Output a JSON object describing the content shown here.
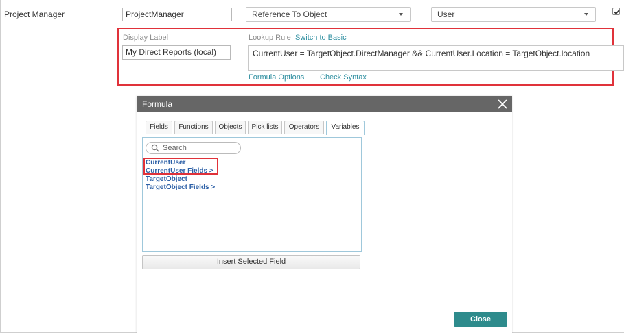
{
  "row": {
    "name_value": "Project Manager",
    "api_name_value": "ProjectManager",
    "type_selected": "Reference To Object",
    "object_selected": "User"
  },
  "lookup": {
    "display_label_title": "Display Label",
    "display_label_value": "My Direct Reports (local)",
    "lookup_rule_title": "Lookup Rule",
    "switch_link": "Switch to Basic",
    "formula_value": "CurrentUser = TargetObject.DirectManager && CurrentUser.Location = TargetObject.location",
    "formula_options_link": "Formula Options",
    "check_syntax_link": "Check Syntax"
  },
  "dialog": {
    "title": "Formula",
    "tabs": [
      "Fields",
      "Functions",
      "Objects",
      "Pick lists",
      "Operators",
      "Variables"
    ],
    "search_placeholder": "Search",
    "items": [
      "CurrentUser",
      "CurrentUser Fields >",
      "TargetObject",
      "TargetObject Fields >"
    ],
    "insert_label": "Insert Selected Field",
    "close_label": "Close"
  },
  "colors": {
    "highlight": "#e0323a",
    "link": "#2f8fa0",
    "close_button": "#2e8b8c",
    "dialog_header": "#666666",
    "list_item": "#2b5fa6"
  }
}
